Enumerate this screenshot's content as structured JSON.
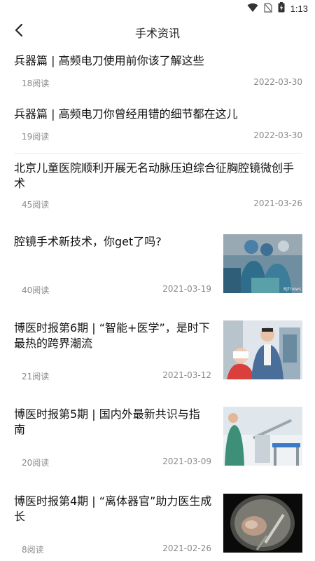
{
  "status_bar": {
    "time": "1:13",
    "icons": [
      "wifi-icon",
      "no-sim-icon",
      "battery-charging-icon"
    ]
  },
  "nav": {
    "title": "手术资讯",
    "back_icon": "chevron-left-icon"
  },
  "articles": [
    {
      "title": "兵器篇 | 高频电刀使用前你该了解这些",
      "reads": "18阅读",
      "date": "2022-03-30"
    },
    {
      "title": "兵器篇 | 高频电刀你曾经用错的细节都在这儿",
      "reads": "19阅读",
      "date": "2022-03-30"
    },
    {
      "title": "北京儿童医院顺利开展无名动脉压迫综合征胸腔镜微创手术",
      "reads": "45阅读",
      "date": "2021-03-26"
    },
    {
      "title": "腔镜手术新技术，你get了吗?",
      "reads": "40阅读",
      "date": "2021-03-19",
      "image": "surgery-team-photo",
      "image_caption": "BJTnews"
    },
    {
      "title": "博医时报第6期 | “智能+医学”，是时下最热的跨界潮流",
      "reads": "21阅读",
      "date": "2021-03-12",
      "image": "doctor-with-robot-photo"
    },
    {
      "title": "博医时报第5期 | 国内外最新共识与指南",
      "reads": "20阅读",
      "date": "2021-03-09",
      "image": "medical-equipment-photo"
    },
    {
      "title": "博医时报第4期 | “离体器官”助力医生成长",
      "reads": "8阅读",
      "date": "2021-02-26",
      "image": "endoscope-view-photo"
    }
  ]
}
